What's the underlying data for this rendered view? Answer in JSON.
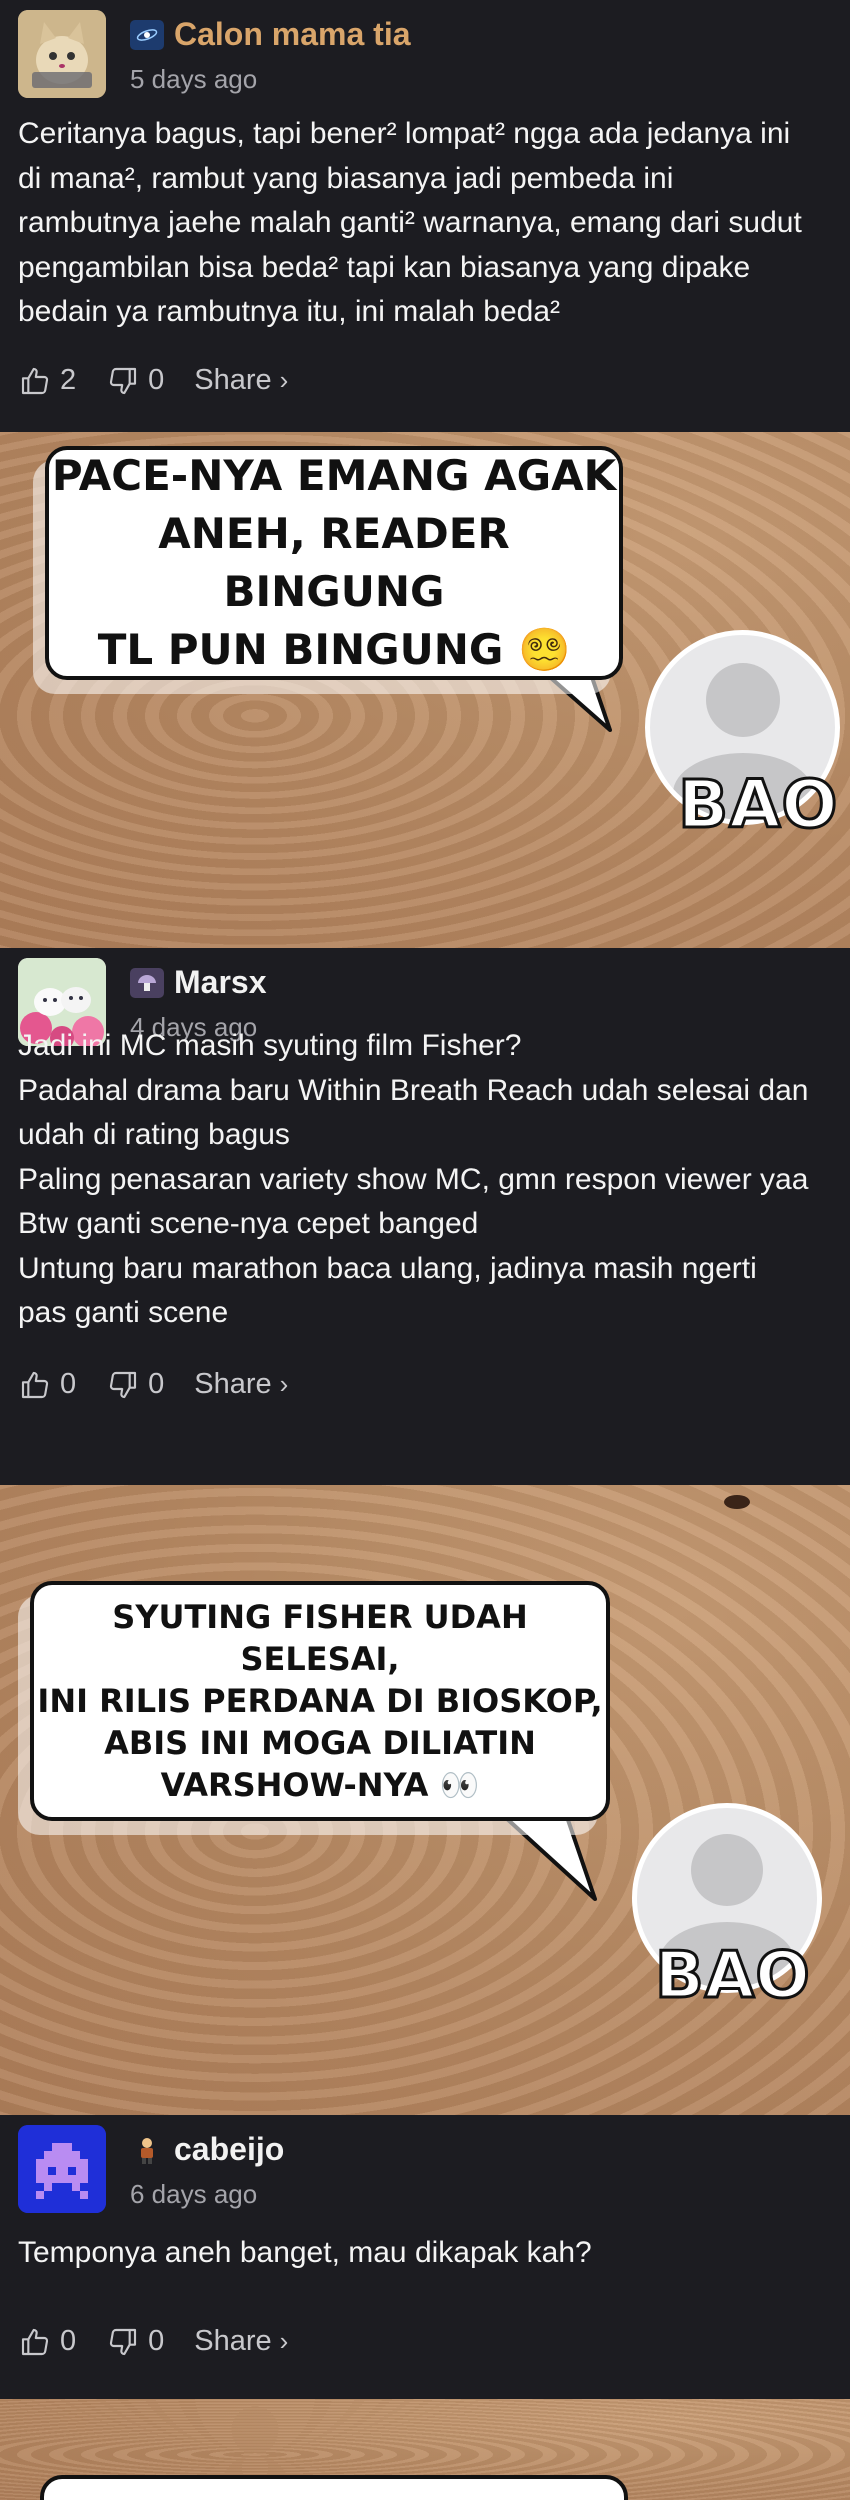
{
  "comments": [
    {
      "name": "Calon mama tia",
      "name_color": "#d9a56a",
      "badge_icon": "galaxy-badge-icon",
      "avatar_icon": "cat-avatar",
      "time": "5 days ago",
      "lines": [
        "Ceritanya bagus, tapi bener² lompat² ngga ada jedanya ini",
        "di mana², rambut yang biasanya jadi pembeda ini",
        "rambutnya jaehe malah ganti² warnanya, emang dari sudut",
        "pengambilan bisa beda² tapi kan biasanya yang dipake",
        "bedain ya rambutnya itu, ini malah beda²"
      ],
      "likes": "2",
      "dislikes": "0",
      "share": "Share"
    },
    {
      "name": "Marsx",
      "name_color": "#ffffff",
      "badge_icon": "mushroom-badge-icon",
      "avatar_icon": "kittens-flowers-avatar",
      "time": "4 days ago",
      "lines": [
        "Jadi ini MC masih syuting film Fisher?",
        "Padahal drama baru Within Breath Reach udah selesai dan",
        "udah di rating bagus",
        "Paling penasaran variety show MC, gmn respon viewer yaa",
        "Btw ganti scene-nya cepet banged",
        "Untung baru marathon baca ulang, jadinya masih ngerti",
        "pas ganti scene"
      ],
      "likes": "0",
      "dislikes": "0",
      "share": "Share"
    },
    {
      "name": "cabeijo",
      "name_color": "#ffffff",
      "badge_icon": "person-badge-icon",
      "avatar_icon": "pixel-invader-avatar",
      "time": "6 days ago",
      "lines": [
        "Temponya aneh banget, mau dikapak kah?"
      ],
      "likes": "0",
      "dislikes": "0",
      "share": "Share"
    }
  ],
  "panels": [
    {
      "bubble_text": "PACE-NYA EMANG AGAK\nANEH, READER BINGUNG\nTL PUN BINGUNG 😵‍💫",
      "speaker": "BAO"
    },
    {
      "bubble_text": "SYUTING FISHER UDAH SELESAI,\nINI RILIS PERDANA DI BIOSKOP,\nABIS INI MOGA DILIATIN\nVARSHOW-NYA 👀",
      "speaker": "BAO"
    }
  ],
  "colors": {
    "background": "#1c1c21",
    "muted_text": "#a4a4aa",
    "panel_sand": "#b88a63"
  }
}
